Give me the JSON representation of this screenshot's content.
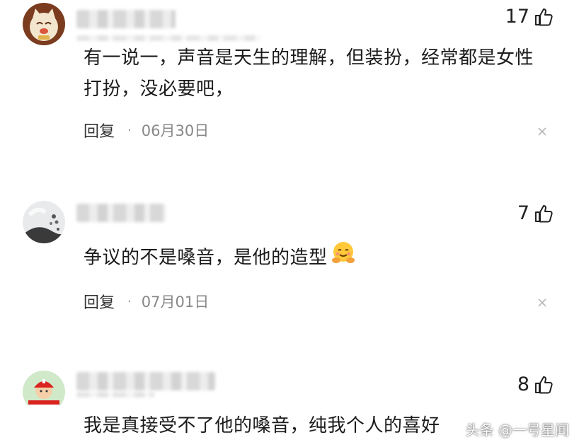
{
  "comments": [
    {
      "likes": "17",
      "text": "有一说一，声音是天生的理解，但装扮，经常都是女性打扮，没必要吧，",
      "reply_label": "回复",
      "dot": "·",
      "date": "06月30日"
    },
    {
      "likes": "7",
      "text": "争议的不是嗓音，是他的造型",
      "reply_label": "回复",
      "dot": "·",
      "date": "07月01日"
    },
    {
      "likes": "8",
      "text": "我是真接受不了他的嗓音，纯我个人的喜好"
    }
  ],
  "watermark": "头条 @一号星闻",
  "icons": {
    "like": "thumbs-up-icon",
    "close": "close-icon",
    "emoji": "hugging-face-emoji"
  }
}
